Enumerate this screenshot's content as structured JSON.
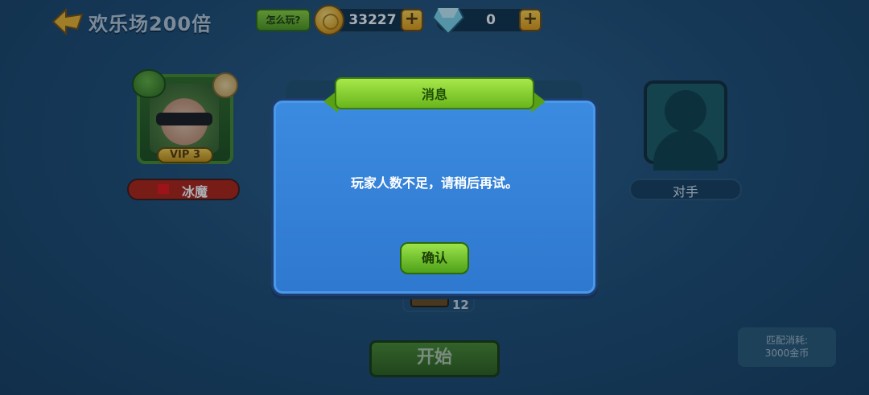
{
  "header": {
    "room_title": "欢乐场200倍",
    "howto_label": "怎么玩?",
    "coins": "33227",
    "gems": "0",
    "plus": "+"
  },
  "player": {
    "name": "冰魔",
    "vip": "VIP 3"
  },
  "opponent": {
    "label": "对手"
  },
  "chest_count": "12",
  "start_label": "开始",
  "cost": {
    "line1": "匹配消耗:",
    "line2": "3000金币"
  },
  "dialog": {
    "title": "消息",
    "message": "玩家人数不足，请稍后再试。",
    "confirm_label": "确认"
  },
  "colors": {
    "background": "#1d4a70",
    "dialog": "#3b8be0",
    "ribbon": "#a7e84a",
    "confirm": "#9be34a"
  }
}
